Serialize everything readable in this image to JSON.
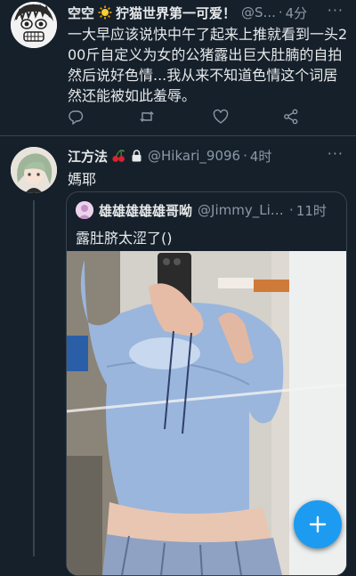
{
  "tweet1": {
    "display_name_part1": "空空",
    "display_name_part2": "狞猫世界第一可爱！",
    "handle": "@S...",
    "separator": "·",
    "time": "4分",
    "more": "···",
    "text": "一大早应该说快中午了起来上推就看到一头200斤自定义为女的公猪露出巨大肚腩的自拍然后说好色情...我从来不知道色情这个词居然还能被如此羞辱。",
    "actions": [
      "reply-icon",
      "retweet-icon",
      "like-icon",
      "share-icon"
    ]
  },
  "tweet2": {
    "display_name": "江方法",
    "handle": "@Hikari_9096",
    "separator": "·",
    "time": "4时",
    "more": "···",
    "text": "媽耶",
    "quote": {
      "display_name": "雄雄雄雄雄哥呦",
      "handle": "@Jimmy_Li5...",
      "separator": "·",
      "time": "11时",
      "text": "露肚脐太涩了()"
    }
  },
  "fab": {
    "icon": "plus-icon"
  },
  "colors": {
    "background": "#15202b",
    "text": "#e7e9ea",
    "secondary": "#8b98a5",
    "accent": "#1d9bf0",
    "border": "#38444d"
  }
}
